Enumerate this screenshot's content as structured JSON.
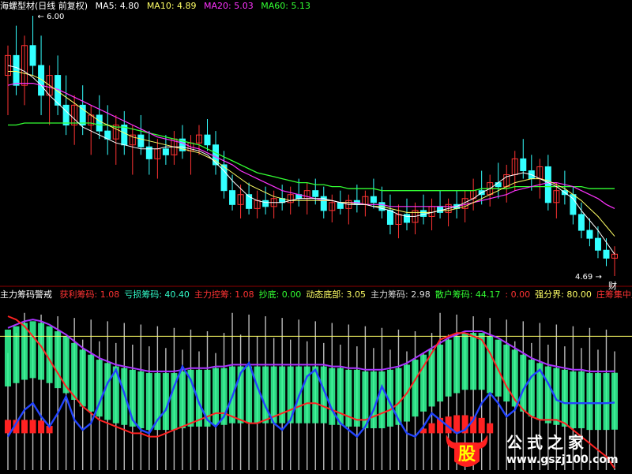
{
  "header": {
    "title": "海螺型材(日线 前复权)",
    "ma5": "MA5: 4.80",
    "ma10": "MA10: 4.89",
    "ma20": "MA20: 5.03",
    "ma60": "MA60: 5.13"
  },
  "price_high_label": "6.00",
  "price_low_label": "4.69",
  "event_marker": "财",
  "indicator_bar": {
    "name": "主力筹码警戒",
    "items": [
      {
        "label": "获利筹码: 1.08",
        "color": "#ff3333"
      },
      {
        "label": "亏损筹码: 40.40",
        "color": "#33ffcc"
      },
      {
        "label": "主力控筹: 1.08",
        "color": "#ff3333"
      },
      {
        "label": "抄底: 0.00",
        "color": "#33ff33"
      },
      {
        "label": "动态底部: 3.05",
        "color": "#ffff66"
      },
      {
        "label": "主力筹码: 2.98",
        "color": "#dddddd"
      },
      {
        "label": "散户筹码: 44.17",
        "color": "#33ff33"
      },
      {
        "label": ": 0.00",
        "color": "#ff3333"
      },
      {
        "label": "强分界: 80.00",
        "color": "#ffff66"
      },
      {
        "label": "庄筹集中监控线",
        "color": "#ff3333"
      }
    ]
  },
  "watermark": {
    "logo_char": "股",
    "name": "公式之家",
    "url": "www.gszj100.com"
  },
  "colors": {
    "up": "#ff3333",
    "down": "#33ffff",
    "ma5": "#ffffff",
    "ma10": "#ffff66",
    "ma20": "#ff33ff",
    "ma60": "#33ff33",
    "indicator_red": "#ff2222",
    "indicator_blue": "#2244ff",
    "indicator_purple": "#aa33ff",
    "band_green": "#33ff99"
  },
  "chart_data": [
    {
      "type": "candlestick",
      "title": "海螺型材(日线 前复权)",
      "ylim": [
        4.69,
        6.0
      ],
      "ohlc": [
        [
          5.7,
          5.85,
          5.5,
          5.8
        ],
        [
          5.8,
          5.95,
          5.6,
          5.65
        ],
        [
          5.65,
          5.9,
          5.55,
          5.85
        ],
        [
          5.85,
          6.0,
          5.7,
          5.75
        ],
        [
          5.75,
          5.9,
          5.5,
          5.6
        ],
        [
          5.6,
          5.75,
          5.45,
          5.7
        ],
        [
          5.7,
          5.8,
          5.5,
          5.55
        ],
        [
          5.55,
          5.7,
          5.4,
          5.45
        ],
        [
          5.45,
          5.6,
          5.35,
          5.55
        ],
        [
          5.55,
          5.65,
          5.4,
          5.45
        ],
        [
          5.45,
          5.55,
          5.3,
          5.5
        ],
        [
          5.5,
          5.6,
          5.38,
          5.42
        ],
        [
          5.42,
          5.55,
          5.3,
          5.38
        ],
        [
          5.38,
          5.5,
          5.25,
          5.45
        ],
        [
          5.45,
          5.52,
          5.3,
          5.35
        ],
        [
          5.35,
          5.45,
          5.2,
          5.4
        ],
        [
          5.4,
          5.5,
          5.3,
          5.34
        ],
        [
          5.34,
          5.42,
          5.2,
          5.28
        ],
        [
          5.28,
          5.38,
          5.18,
          5.33
        ],
        [
          5.33,
          5.4,
          5.25,
          5.3
        ],
        [
          5.3,
          5.42,
          5.25,
          5.38
        ],
        [
          5.38,
          5.45,
          5.28,
          5.32
        ],
        [
          5.32,
          5.4,
          5.2,
          5.36
        ],
        [
          5.36,
          5.45,
          5.3,
          5.4
        ],
        [
          5.4,
          5.48,
          5.32,
          5.35
        ],
        [
          5.35,
          5.42,
          5.2,
          5.25
        ],
        [
          5.25,
          5.32,
          5.08,
          5.12
        ],
        [
          5.12,
          5.2,
          5.02,
          5.05
        ],
        [
          5.05,
          5.15,
          4.98,
          5.1
        ],
        [
          5.1,
          5.16,
          5.0,
          5.03
        ],
        [
          5.03,
          5.12,
          4.98,
          5.07
        ],
        [
          5.07,
          5.14,
          5.0,
          5.04
        ],
        [
          5.04,
          5.12,
          4.98,
          5.08
        ],
        [
          5.08,
          5.15,
          5.02,
          5.06
        ],
        [
          5.06,
          5.14,
          5.0,
          5.1
        ],
        [
          5.1,
          5.18,
          5.04,
          5.08
        ],
        [
          5.08,
          5.16,
          5.0,
          5.12
        ],
        [
          5.12,
          5.18,
          5.05,
          5.09
        ],
        [
          5.09,
          5.14,
          4.98,
          5.02
        ],
        [
          5.02,
          5.1,
          4.96,
          5.06
        ],
        [
          5.06,
          5.12,
          5.0,
          5.03
        ],
        [
          5.03,
          5.1,
          4.95,
          5.07
        ],
        [
          5.07,
          5.15,
          5.01,
          5.05
        ],
        [
          5.05,
          5.12,
          4.99,
          5.09
        ],
        [
          5.09,
          5.18,
          5.03,
          5.06
        ],
        [
          5.06,
          5.14,
          4.98,
          5.02
        ],
        [
          5.02,
          5.1,
          4.9,
          4.95
        ],
        [
          4.95,
          5.05,
          4.88,
          5.0
        ],
        [
          5.0,
          5.08,
          4.92,
          4.96
        ],
        [
          4.96,
          5.06,
          4.9,
          5.02
        ],
        [
          5.02,
          5.1,
          4.95,
          4.99
        ],
        [
          4.99,
          5.08,
          4.92,
          5.04
        ],
        [
          5.04,
          5.12,
          4.98,
          5.01
        ],
        [
          5.01,
          5.08,
          4.94,
          5.05
        ],
        [
          5.05,
          5.12,
          4.98,
          5.03
        ],
        [
          5.03,
          5.12,
          4.96,
          5.08
        ],
        [
          5.08,
          5.18,
          5.02,
          5.12
        ],
        [
          5.12,
          5.22,
          5.05,
          5.1
        ],
        [
          5.1,
          5.2,
          5.04,
          5.16
        ],
        [
          5.16,
          5.26,
          5.08,
          5.14
        ],
        [
          5.14,
          5.25,
          5.06,
          5.2
        ],
        [
          5.2,
          5.32,
          5.12,
          5.28
        ],
        [
          5.28,
          5.38,
          5.18,
          5.22
        ],
        [
          5.22,
          5.3,
          5.12,
          5.18
        ],
        [
          5.18,
          5.28,
          5.08,
          5.24
        ],
        [
          5.24,
          5.3,
          5.02,
          5.06
        ],
        [
          5.06,
          5.16,
          4.98,
          5.12
        ],
        [
          5.12,
          5.22,
          5.05,
          5.1
        ],
        [
          5.1,
          5.14,
          4.95,
          5.0
        ],
        [
          5.0,
          5.06,
          4.88,
          4.92
        ],
        [
          4.92,
          4.98,
          4.84,
          4.88
        ],
        [
          4.88,
          4.94,
          4.78,
          4.82
        ],
        [
          4.82,
          4.88,
          4.74,
          4.78
        ],
        [
          4.78,
          4.84,
          4.69,
          4.8
        ]
      ],
      "ma5": [
        5.75,
        5.74,
        5.72,
        5.69,
        5.65,
        5.6,
        5.56,
        5.52,
        5.48,
        5.44,
        5.42,
        5.4,
        5.38,
        5.36,
        5.35,
        5.34,
        5.33,
        5.33,
        5.33,
        5.34,
        5.34,
        5.34,
        5.33,
        5.32,
        5.3,
        5.26,
        5.22,
        5.17,
        5.13,
        5.09,
        5.07,
        5.06,
        5.06,
        5.06,
        5.07,
        5.08,
        5.08,
        5.08,
        5.08,
        5.07,
        5.06,
        5.05,
        5.05,
        5.05,
        5.04,
        5.03,
        5.02,
        5.0,
        4.99,
        4.99,
        5.0,
        5.01,
        5.02,
        5.03,
        5.04,
        5.06,
        5.08,
        5.11,
        5.13,
        5.16,
        5.19,
        5.2,
        5.21,
        5.2,
        5.18,
        5.16,
        5.14,
        5.11,
        5.08,
        5.02,
        4.97,
        4.92,
        4.86,
        4.8
      ],
      "ma10": [
        5.72,
        5.72,
        5.71,
        5.7,
        5.68,
        5.65,
        5.62,
        5.59,
        5.56,
        5.53,
        5.5,
        5.47,
        5.45,
        5.43,
        5.41,
        5.39,
        5.38,
        5.37,
        5.36,
        5.35,
        5.34,
        5.33,
        5.32,
        5.31,
        5.29,
        5.27,
        5.24,
        5.21,
        5.18,
        5.15,
        5.13,
        5.11,
        5.09,
        5.08,
        5.07,
        5.07,
        5.07,
        5.07,
        5.07,
        5.07,
        5.06,
        5.06,
        5.05,
        5.05,
        5.04,
        5.04,
        5.03,
        5.02,
        5.01,
        5.01,
        5.01,
        5.01,
        5.02,
        5.02,
        5.03,
        5.04,
        5.06,
        5.08,
        5.1,
        5.12,
        5.14,
        5.16,
        5.17,
        5.18,
        5.18,
        5.17,
        5.15,
        5.13,
        5.1,
        5.07,
        5.03,
        4.99,
        4.94,
        4.89
      ],
      "ma20": [
        5.65,
        5.66,
        5.66,
        5.66,
        5.65,
        5.64,
        5.63,
        5.61,
        5.59,
        5.57,
        5.55,
        5.53,
        5.51,
        5.49,
        5.47,
        5.45,
        5.43,
        5.41,
        5.39,
        5.38,
        5.37,
        5.36,
        5.34,
        5.33,
        5.31,
        5.29,
        5.27,
        5.25,
        5.22,
        5.2,
        5.18,
        5.16,
        5.14,
        5.12,
        5.11,
        5.1,
        5.09,
        5.08,
        5.07,
        5.07,
        5.06,
        5.06,
        5.06,
        5.05,
        5.05,
        5.05,
        5.04,
        5.04,
        5.04,
        5.04,
        5.04,
        5.04,
        5.04,
        5.04,
        5.04,
        5.05,
        5.06,
        5.07,
        5.08,
        5.09,
        5.1,
        5.12,
        5.13,
        5.14,
        5.15,
        5.16,
        5.16,
        5.15,
        5.14,
        5.12,
        5.1,
        5.08,
        5.05,
        5.03
      ],
      "ma60": [
        5.45,
        5.45,
        5.46,
        5.46,
        5.46,
        5.46,
        5.46,
        5.46,
        5.46,
        5.46,
        5.46,
        5.45,
        5.45,
        5.44,
        5.44,
        5.43,
        5.42,
        5.41,
        5.4,
        5.39,
        5.38,
        5.37,
        5.36,
        5.35,
        5.33,
        5.31,
        5.29,
        5.27,
        5.25,
        5.23,
        5.21,
        5.2,
        5.19,
        5.18,
        5.17,
        5.16,
        5.16,
        5.15,
        5.15,
        5.14,
        5.14,
        5.13,
        5.13,
        5.13,
        5.13,
        5.12,
        5.12,
        5.12,
        5.12,
        5.12,
        5.12,
        5.12,
        5.12,
        5.12,
        5.12,
        5.12,
        5.12,
        5.13,
        5.13,
        5.13,
        5.13,
        5.14,
        5.14,
        5.14,
        5.14,
        5.14,
        5.14,
        5.14,
        5.14,
        5.14,
        5.13,
        5.13,
        5.13,
        5.13
      ]
    },
    {
      "type": "line",
      "title": "主力筹码警戒",
      "ylim": [
        0,
        100
      ],
      "strong_boundary": 80,
      "series": [
        {
          "name": "获利筹码",
          "values": [
            92,
            90,
            86,
            80,
            74,
            66,
            58,
            50,
            44,
            38,
            34,
            30,
            28,
            26,
            24,
            22,
            22,
            20,
            20,
            22,
            24,
            26,
            28,
            30,
            32,
            34,
            34,
            32,
            30,
            28,
            28,
            30,
            32,
            34,
            36,
            38,
            40,
            40,
            38,
            36,
            34,
            32,
            30,
            30,
            32,
            34,
            36,
            40,
            46,
            54,
            62,
            70,
            78,
            80,
            82,
            82,
            80,
            78,
            70,
            60,
            50,
            42,
            36,
            32,
            30,
            30,
            30,
            28,
            24,
            20,
            16,
            12,
            8,
            1.08
          ]
        },
        {
          "name": "亏损筹码",
          "values": [
            20,
            28,
            36,
            40,
            32,
            26,
            34,
            44,
            30,
            24,
            28,
            40,
            52,
            60,
            46,
            30,
            24,
            22,
            30,
            36,
            50,
            62,
            54,
            40,
            30,
            26,
            32,
            44,
            58,
            64,
            50,
            38,
            28,
            24,
            30,
            44,
            56,
            60,
            48,
            36,
            28,
            24,
            20,
            26,
            36,
            50,
            40,
            30,
            22,
            20,
            26,
            34,
            30,
            26,
            22,
            24,
            30,
            40,
            46,
            40,
            32,
            36,
            48,
            56,
            60,
            52,
            42,
            40,
            40,
            40,
            40,
            40,
            40,
            40.4
          ]
        },
        {
          "name": "散户筹码",
          "values": [
            70,
            72,
            74,
            75,
            74,
            72,
            69,
            66,
            62,
            58,
            55,
            52,
            50,
            48,
            47,
            46,
            45,
            44,
            44,
            44,
            44,
            45,
            46,
            46,
            46,
            47,
            47,
            48,
            48,
            48,
            48,
            48,
            48,
            48,
            48,
            48,
            48,
            48,
            48,
            47,
            47,
            46,
            46,
            45,
            45,
            45,
            46,
            47,
            49,
            52,
            55,
            58,
            61,
            64,
            66,
            68,
            68,
            68,
            66,
            64,
            61,
            58,
            55,
            52,
            50,
            48,
            47,
            46,
            45,
            45,
            44,
            44,
            44,
            44.17
          ]
        }
      ]
    }
  ]
}
